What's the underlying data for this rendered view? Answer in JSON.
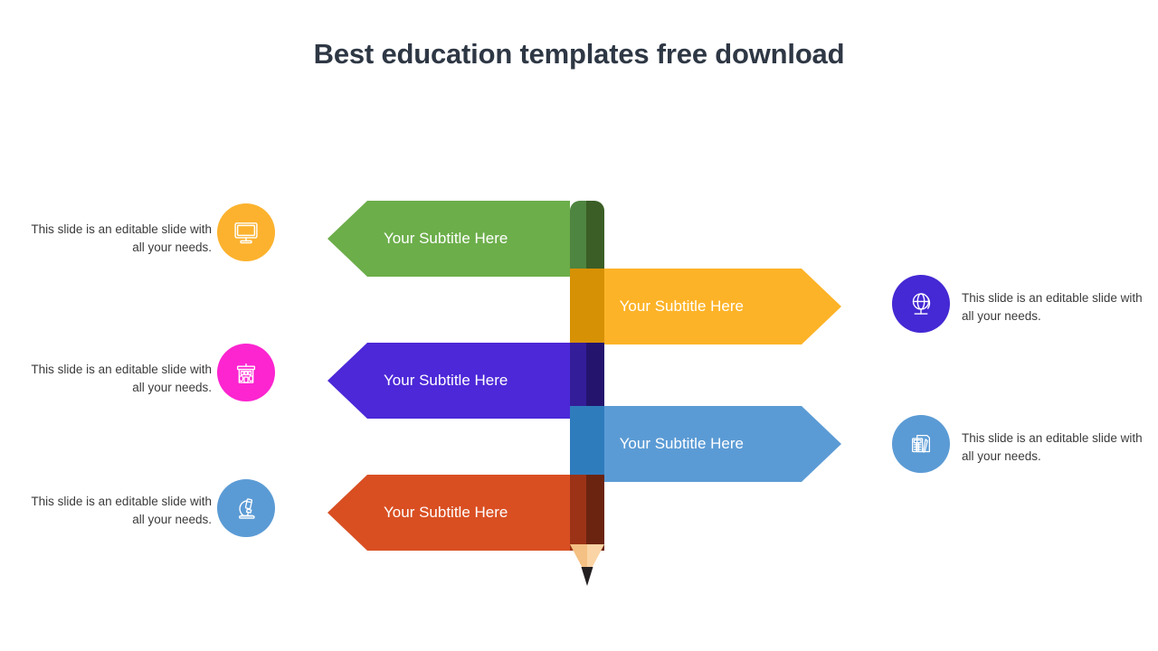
{
  "slide": {
    "title": "Best education templates free download",
    "title_color": "#2e3744",
    "background": "#ffffff"
  },
  "pencil": {
    "name": "vertical-pencil-graphic",
    "tip_light": "#f5c083",
    "tip_pale": "#fad4a4",
    "graphite": "#231f20",
    "segments": [
      {
        "key": "green",
        "mid": "#4e8540",
        "dark": "#3a5e26"
      },
      {
        "key": "orange",
        "mid": "#d79105",
        "dark": "#d79105"
      },
      {
        "key": "purple",
        "mid": "#341d99",
        "dark": "#24146e"
      },
      {
        "key": "blue",
        "mid": "#2f7cbd",
        "dark": "#2f7cbd"
      },
      {
        "key": "red",
        "mid": "#9c3317",
        "dark": "#6b2410"
      }
    ]
  },
  "rows": [
    {
      "key": "row-green",
      "direction": "left",
      "label": "Your Subtitle Here",
      "color": "#6cae4a",
      "description": "This slide is an editable slide with all your needs.",
      "icon": {
        "name": "monitor-icon",
        "circle_color": "#fcb22e"
      }
    },
    {
      "key": "row-orange",
      "direction": "right",
      "label": "Your Subtitle Here",
      "color": "#fdb327",
      "description": "This slide is an editable slide with all your needs.",
      "icon": {
        "name": "globe-icon",
        "circle_color": "#4429d4"
      }
    },
    {
      "key": "row-purple",
      "direction": "left",
      "label": "Your Subtitle Here",
      "color": "#4c28d8",
      "description": "This slide is an editable slide with all your needs.",
      "icon": {
        "name": "school-building-icon",
        "circle_color": "#fc25d0"
      }
    },
    {
      "key": "row-blue",
      "direction": "right",
      "label": "Your Subtitle Here",
      "color": "#5b9bd5",
      "description": "This slide is an editable slide with all your needs.",
      "icon": {
        "name": "calculator-document-icon",
        "circle_color": "#5b9bd5"
      }
    },
    {
      "key": "row-red",
      "direction": "left",
      "label": "Your Subtitle Here",
      "color": "#d94f22",
      "description": "This slide is an editable slide with all your needs.",
      "icon": {
        "name": "microscope-icon",
        "circle_color": "#5b9bd5"
      }
    }
  ]
}
